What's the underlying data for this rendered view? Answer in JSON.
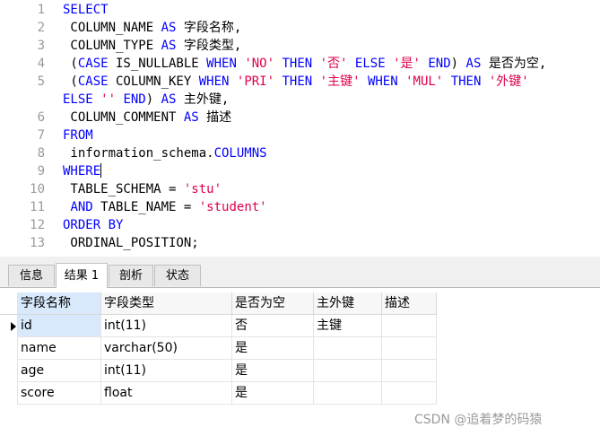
{
  "editor": {
    "line_numbers": [
      "1",
      "2",
      "3",
      "4",
      "5",
      "6",
      "7",
      "8",
      "9",
      "10",
      "11",
      "12",
      "13"
    ],
    "tokens": {
      "l1_select": "SELECT",
      "l2_col": " COLUMN_NAME ",
      "l2_as": "AS",
      "l2_alias": " 字段名称,",
      "l3_col": " COLUMN_TYPE ",
      "l3_as": "AS",
      "l3_alias": " 字段类型,",
      "l4_p1": " (",
      "l4_case": "CASE",
      "l4_col": " IS_NULLABLE ",
      "l4_when": "WHEN",
      "l4_sp1": " ",
      "l4_no": "'NO'",
      "l4_sp2": " ",
      "l4_then": "THEN",
      "l4_sp3": " ",
      "l4_fou": "'否'",
      "l4_sp4": " ",
      "l4_else": "ELSE",
      "l4_sp5": " ",
      "l4_shi": "'是'",
      "l4_sp6": " ",
      "l4_end": "END",
      "l4_p2": ") ",
      "l4_as": "AS",
      "l4_alias": " 是否为空,",
      "l5_p1": " (",
      "l5_case": "CASE",
      "l5_col": " COLUMN_KEY ",
      "l5_when": "WHEN",
      "l5_sp1": " ",
      "l5_pri": "'PRI'",
      "l5_sp2": " ",
      "l5_then": "THEN",
      "l5_sp3": " ",
      "l5_zhujian": "'主键'",
      "l5_sp4": " ",
      "l5_when2": "WHEN",
      "l5_sp5": " ",
      "l5_mul": "'MUL'",
      "l5_sp6": " ",
      "l5_then2": "THEN",
      "l5_sp7": " ",
      "l5_waijian": "'外键'",
      "l5b_else": "ELSE",
      "l5b_sp1": " ",
      "l5b_empty": "''",
      "l5b_sp2": " ",
      "l5b_end": "END",
      "l5b_p2": ") ",
      "l5b_as": "AS",
      "l5b_alias": " 主外键,",
      "l6_col": " COLUMN_COMMENT ",
      "l6_as": "AS",
      "l6_alias": " 描述",
      "l7_from": "FROM",
      "l8_schema": " information_schema.",
      "l8_columns": "COLUMNS",
      "l9_where": "WHERE",
      "l10_col": " TABLE_SCHEMA = ",
      "l10_val": "'stu'",
      "l11_sp": " ",
      "l11_and": "AND",
      "l11_col": " TABLE_NAME = ",
      "l11_val": "'student'",
      "l12_order": "ORDER BY",
      "l13_col": " ORDINAL_POSITION;"
    }
  },
  "tabs": [
    {
      "label": "信息"
    },
    {
      "label": "结果 1"
    },
    {
      "label": "剖析"
    },
    {
      "label": "状态"
    }
  ],
  "grid": {
    "columns": [
      "字段名称",
      "字段类型",
      "是否为空",
      "主外键",
      "描述"
    ],
    "rows": [
      [
        "id",
        "int(11)",
        "否",
        "主键",
        ""
      ],
      [
        "name",
        "varchar(50)",
        "是",
        "",
        ""
      ],
      [
        "age",
        "int(11)",
        "是",
        "",
        ""
      ],
      [
        "score",
        "float",
        "是",
        "",
        ""
      ]
    ]
  },
  "watermark": "CSDN @追着梦的码猿"
}
